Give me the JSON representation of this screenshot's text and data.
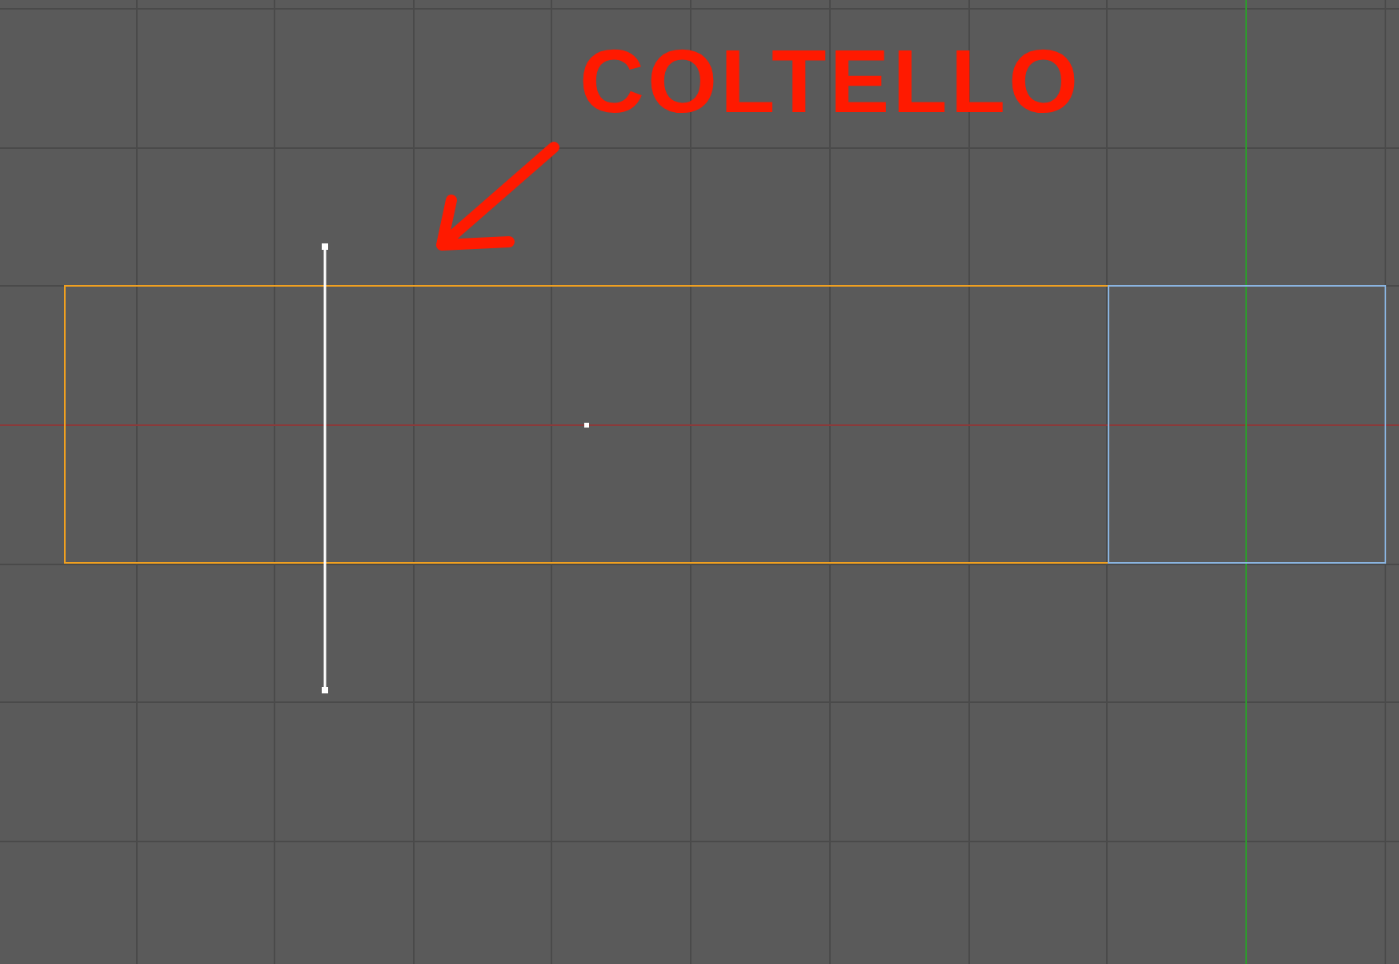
{
  "viewport": {
    "annotation": {
      "text": "COLTELLO"
    },
    "objects": [
      {
        "kind": "face",
        "selected": true
      },
      {
        "kind": "face",
        "selected": false
      }
    ]
  }
}
